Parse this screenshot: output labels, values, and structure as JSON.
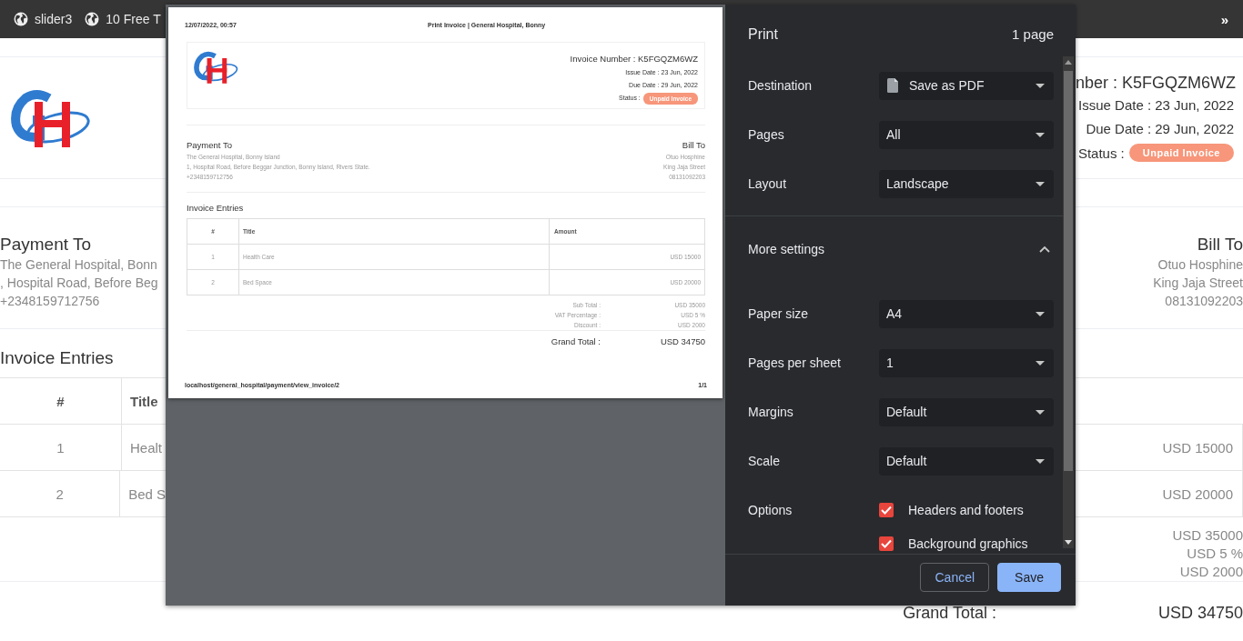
{
  "bookmarks_bar": {
    "items": [
      {
        "label": "slider3"
      },
      {
        "label": "10 Free T"
      }
    ],
    "overflow": "»"
  },
  "page": {
    "invoice_number": "nber : K5FGQZM6WZ",
    "issue_date": "Issue Date : 23 Jun, 2022",
    "due_date": "Due Date : 29 Jun, 2022",
    "status_label": "Status :",
    "status_badge": "Unpaid Invoice",
    "payment_to": {
      "heading": "Payment To",
      "lines": [
        "The General Hospital, Bonn",
        ", Hospital Road, Before Beg",
        "+2348159712756"
      ]
    },
    "bill_to": {
      "heading": "Bill To",
      "lines": [
        "Otuo Hosphine",
        "King Jaja Street",
        "08131092203"
      ]
    },
    "entries_heading": "Invoice Entries",
    "table": {
      "columns": [
        "#",
        "Title"
      ],
      "rows": [
        {
          "number": "1",
          "title": "Healt",
          "amount": "USD 15000"
        },
        {
          "number": "2",
          "title": "Bed S",
          "amount": "USD 20000"
        }
      ]
    },
    "totals": [
      "USD 35000",
      "USD 5 %",
      "USD 2000"
    ],
    "grand_total": {
      "label": "Grand Total :",
      "value": "USD 34750"
    }
  },
  "print_dialog": {
    "preview": {
      "header_left": "12/07/2022, 00:57",
      "header_center": "Print Invoice | General Hospital, Bonny",
      "invoice_number": "Invoice Number : K5FGQZM6WZ",
      "issue_date": "Issue Date : 23 Jun, 2022",
      "due_date": "Due Date : 29 Jun, 2022",
      "status_label": "Status :",
      "status_badge": "Unpaid Invoice",
      "payment_to": {
        "heading": "Payment To",
        "lines": [
          "The General Hospital, Bonny Island",
          "1, Hospital Road, Before Beggar Junction, Bonny Island, Rivers State.",
          "+2348159712756"
        ]
      },
      "bill_to": {
        "heading": "Bill To",
        "lines": [
          "Otuo Hosphine",
          "King Jaja Street",
          "08131092203"
        ]
      },
      "entries_heading": "Invoice Entries",
      "table": {
        "columns": [
          "#",
          "Title",
          "Amount"
        ],
        "rows": [
          {
            "number": "1",
            "title": "Health Care",
            "amount": "USD 15000"
          },
          {
            "number": "2",
            "title": "Bed Space",
            "amount": "USD 20000"
          }
        ]
      },
      "totals": [
        {
          "label": "Sub Total :",
          "value": "USD 35000"
        },
        {
          "label": "VAT Percentage :",
          "value": "USD 5 %"
        },
        {
          "label": "Discount :",
          "value": "USD 2000"
        }
      ],
      "grand_total": {
        "label": "Grand Total :",
        "value": "USD 34750"
      },
      "footer_left": "localhost/general_hospital/payment/view_invoice/2",
      "footer_right": "1/1"
    },
    "title": "Print",
    "page_count": "1 page",
    "settings": [
      {
        "kind": "destination",
        "label": "Destination",
        "value": "Save as PDF"
      },
      {
        "kind": "select",
        "label": "Pages",
        "value": "All"
      },
      {
        "kind": "select",
        "label": "Layout",
        "value": "Landscape"
      },
      {
        "kind": "section",
        "label": "More settings",
        "expanded": true
      },
      {
        "kind": "select",
        "label": "Paper size",
        "value": "A4"
      },
      {
        "kind": "select",
        "label": "Pages per sheet",
        "value": "1"
      },
      {
        "kind": "select",
        "label": "Margins",
        "value": "Default"
      },
      {
        "kind": "select",
        "label": "Scale",
        "value": "Default"
      },
      {
        "kind": "checkboxes",
        "label": "Options",
        "options": [
          {
            "label": "Headers and footers",
            "checked": true
          },
          {
            "label": "Background graphics",
            "checked": true
          }
        ]
      }
    ],
    "buttons": [
      {
        "label": "Cancel",
        "kind": "secondary"
      },
      {
        "label": "Save",
        "kind": "primary"
      }
    ]
  }
}
